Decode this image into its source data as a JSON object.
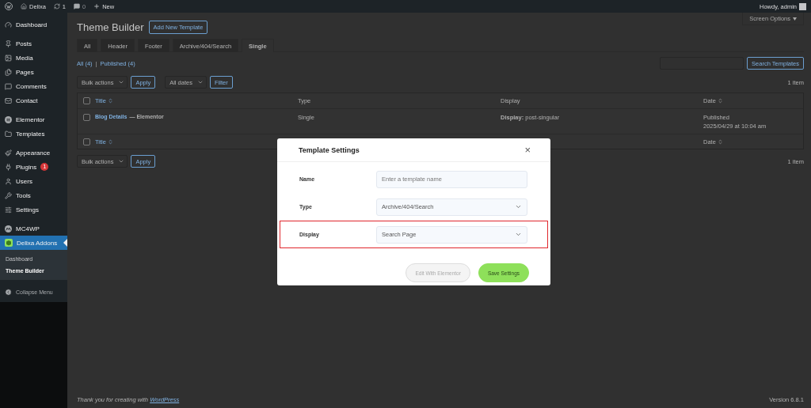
{
  "admin_bar": {
    "site": "Delixa",
    "updates": "1",
    "comments": "0",
    "new": "New",
    "greeting": "Howdy, admin"
  },
  "sidebar": {
    "groups": [
      [
        {
          "label": "Dashboard",
          "selected": false
        }
      ],
      [
        {
          "label": "Posts",
          "selected": false
        },
        {
          "label": "Media",
          "selected": false
        },
        {
          "label": "Pages",
          "selected": false
        },
        {
          "label": "Comments",
          "selected": false
        },
        {
          "label": "Contact",
          "selected": false
        }
      ],
      [
        {
          "label": "Elementor",
          "selected": false
        },
        {
          "label": "Templates",
          "selected": false
        }
      ],
      [
        {
          "label": "Appearance",
          "selected": false
        },
        {
          "label": "Plugins",
          "selected": false,
          "badge": "1"
        },
        {
          "label": "Users",
          "selected": false
        },
        {
          "label": "Tools",
          "selected": false
        },
        {
          "label": "Settings",
          "selected": false
        }
      ],
      [
        {
          "label": "MC4WP",
          "selected": false
        },
        {
          "label": "Delixa Addons",
          "selected": true,
          "children": [
            {
              "label": "Dashboard",
              "selected": false
            },
            {
              "label": "Theme Builder",
              "selected": true
            }
          ]
        }
      ]
    ],
    "collapse": "Collapse Menu"
  },
  "screen_options": "Screen Options",
  "page": {
    "title": "Theme Builder",
    "add_button": "Add New Template",
    "tabs": [
      {
        "label": "All",
        "selected": false
      },
      {
        "label": "Header",
        "selected": false
      },
      {
        "label": "Footer",
        "selected": false
      },
      {
        "label": "Archive/404/Search",
        "selected": false
      },
      {
        "label": "Single",
        "selected": true
      }
    ],
    "views": [
      {
        "label": "All (4)"
      },
      {
        "label": "Published (4)"
      }
    ],
    "views_separator": "|",
    "search_button": "Search Templates",
    "top_actions": {
      "bulk": "Bulk actions",
      "apply": "Apply",
      "dates": "All dates",
      "filter": "Filter",
      "count": "1 item"
    },
    "table": {
      "header": {
        "select_all_checked": false,
        "columns": [
          "Title",
          "Type",
          "Display",
          "Date"
        ]
      },
      "footer": {
        "select_all_checked": false,
        "title_column": "Title",
        "date_column": "Date"
      },
      "rows": [
        {
          "title": "Blog Details",
          "suffix": "— Elementor",
          "type": "Single",
          "display": "**Display:** post-singular",
          "status": "Published",
          "date": "2025/04/29 at 10:04 am",
          "checked": false
        }
      ]
    },
    "bottom_actions": {
      "bulk": "Bulk actions",
      "apply": "Apply",
      "count": "1 item"
    }
  },
  "modal": {
    "title": "Template Settings",
    "close": "×",
    "fields": [
      {
        "kind": "text",
        "label": "Name",
        "placeholder": "Enter a template name",
        "highlighted": false
      },
      {
        "kind": "select",
        "label": "Type",
        "value": "Archive/404/Search",
        "highlighted": false
      },
      {
        "kind": "select",
        "label": "Display",
        "value": "Search Page",
        "highlighted": true
      }
    ],
    "buttons": [
      {
        "label": "Edit With Elementor",
        "disabled": true
      },
      {
        "label": "Save Settings",
        "disabled": false
      }
    ]
  },
  "footer": {
    "thanks": "Thank you for creating with",
    "link": "WordPress",
    "version": "Version 6.8.1"
  }
}
